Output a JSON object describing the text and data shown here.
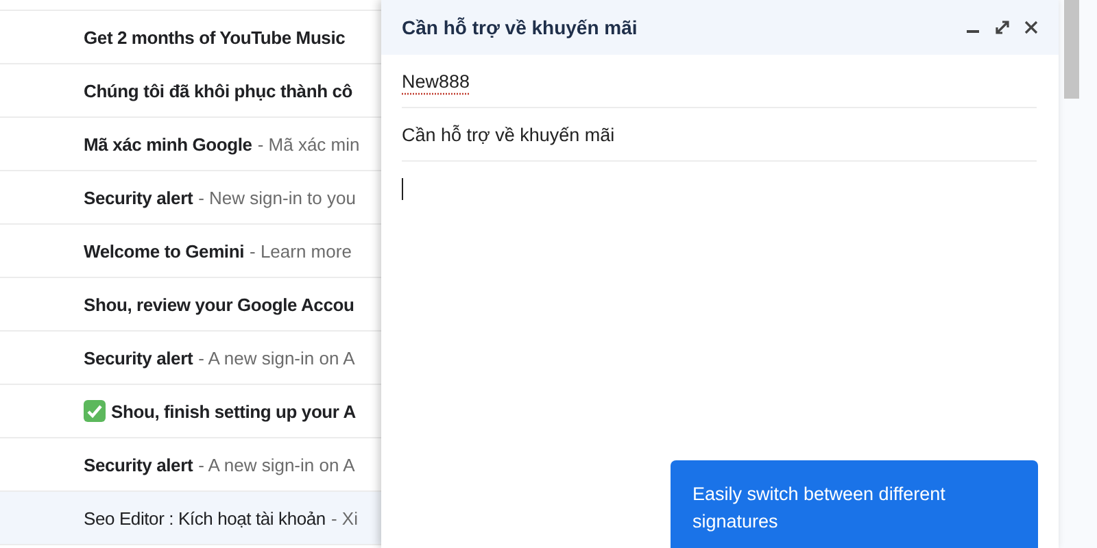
{
  "mail_list": [
    {
      "subject": "Get 2 months of YouTube Music",
      "read": false,
      "kind": "plain"
    },
    {
      "subject": "Chúng tôi đã khôi phục thành cô",
      "read": false,
      "kind": "plain"
    },
    {
      "subject": "Mã xác minh Google",
      "snippet": "- Mã xác min",
      "read": false,
      "kind": "plain"
    },
    {
      "subject": "Security alert",
      "snippet": "- New sign-in to you",
      "read": false,
      "kind": "plain"
    },
    {
      "subject": "Welcome to Gemini",
      "snippet": "- Learn more",
      "read": false,
      "kind": "plain"
    },
    {
      "subject": "Shou, review your Google Accou",
      "read": false,
      "kind": "plain"
    },
    {
      "subject": "Security alert",
      "snippet": "- A new sign-in on A",
      "read": false,
      "kind": "plain"
    },
    {
      "subject": "Shou, finish setting up your A",
      "read": false,
      "kind": "check"
    },
    {
      "subject": "Security alert",
      "snippet": "- A new sign-in on A",
      "read": false,
      "kind": "plain"
    },
    {
      "subject": "Seo Editor : Kích hoạt tài khoản",
      "snippet": "- Xi",
      "read": true,
      "kind": "plain"
    }
  ],
  "compose": {
    "title": "Cần hỗ trợ về khuyến mãi",
    "recipient": "New888",
    "subject": "Cần hỗ trợ về khuyến mãi"
  },
  "tooltip": {
    "text": "Easily switch between different signatures"
  }
}
